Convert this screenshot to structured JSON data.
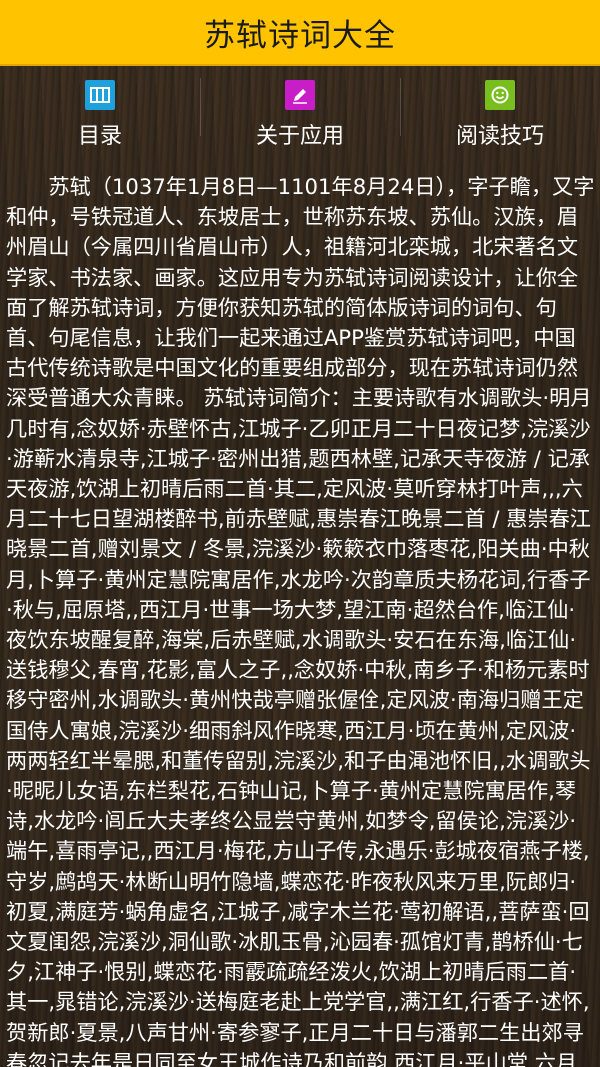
{
  "app": {
    "title": "苏轼诗词大全"
  },
  "nav": {
    "items": [
      {
        "label": "目录",
        "icon": "book-icon",
        "color": "#1ea0dc"
      },
      {
        "label": "关于应用",
        "icon": "pencil-icon",
        "color": "#c81ec8"
      },
      {
        "label": "阅读技巧",
        "icon": "smiley-icon",
        "color": "#78be1e"
      }
    ]
  },
  "content": {
    "intro": "苏轼（1037年1月8日—1101年8月24日），字子瞻，又字和仲，号铁冠道人、东坡居士，世称苏东坡、苏仙。汉族，眉州眉山（今属四川省眉山市）人，祖籍河北栾城，北宋著名文学家、书法家、画家。这应用专为苏轼诗词阅读设计，让你全面了解苏轼诗词，方便你获知苏轼的简体版诗词的词句、句首、句尾信息，让我们一起来通过APP鉴赏苏轼诗词吧，中国古代传统诗歌是中国文化的重要组成部分，现在苏轼诗词仍然深受普通大众青睐。 苏轼诗词简介：主要诗歌有水调歌头·明月几时有,念奴娇·赤壁怀古,江城子·乙卯正月二十日夜记梦,浣溪沙·游蕲水清泉寺,江城子·密州出猎,题西林壁,记承天寺夜游 / 记承天夜游,饮湖上初晴后雨二首·其二,定风波·莫听穿林打叶声,,,六月二十七日望湖楼醉书,前赤壁赋,惠崇春江晚景二首 / 惠崇春江晓景二首,赠刘景文 / 冬景,浣溪沙·簌簌衣巾落枣花,阳关曲·中秋月,卜算子·黄州定慧院寓居作,水龙吟·次韵章质夫杨花词,行香子·秋与,屈原塔,,西江月·世事一场大梦,望江南·超然台作,临江仙·夜饮东坡醒复醉,海棠,后赤壁赋,水调歌头·安石在东海,临江仙·送钱穆父,春宵,花影,富人之子,,念奴娇·中秋,南乡子·和杨元素时移守密州,水调歌头·黄州快哉亭赠张偓佺,定风波·南海归赠王定国侍人寓娘,浣溪沙·细雨斜风作晓寒,西江月·顷在黄州,定风波·两两轻红半晕腮,和董传留别,浣溪沙,和子由渑池怀旧,,水调歌头·昵昵儿女语,东栏梨花,石钟山记,卜算子·黄州定慧院寓居作,琴诗,水龙吟·闾丘大夫孝终公显尝守黄州,如梦令,留侯论,浣溪沙·端午,喜雨亭记,,西江月·梅花,方山子传,永遇乐·彭城夜宿燕子楼,守岁,鹧鸪天·林断山明竹隐墙,蝶恋花·昨夜秋风来万里,阮郎归·初夏,满庭芳·蜗角虚名,江城子,减字木兰花·莺初解语,,菩萨蛮·回文夏闺怨,浣溪沙,洞仙歌·冰肌玉骨,沁园春·孤馆灯青,鹊桥仙·七夕,江神子·恨别,蝶恋花·雨霰疏疏经泼火,饮湖上初晴后雨二首·其一,晁错论,浣溪沙·送梅庭老赴上党学官,,满江红,行香子·述怀,贺新郎·夏景,八声甘州·寄参寥子,正月二十日与潘郭二生出郊寻春忽记去年是日同至女王城作诗乃和前韵,西江月·平山堂,六月二十日夜渡海,"
  }
}
